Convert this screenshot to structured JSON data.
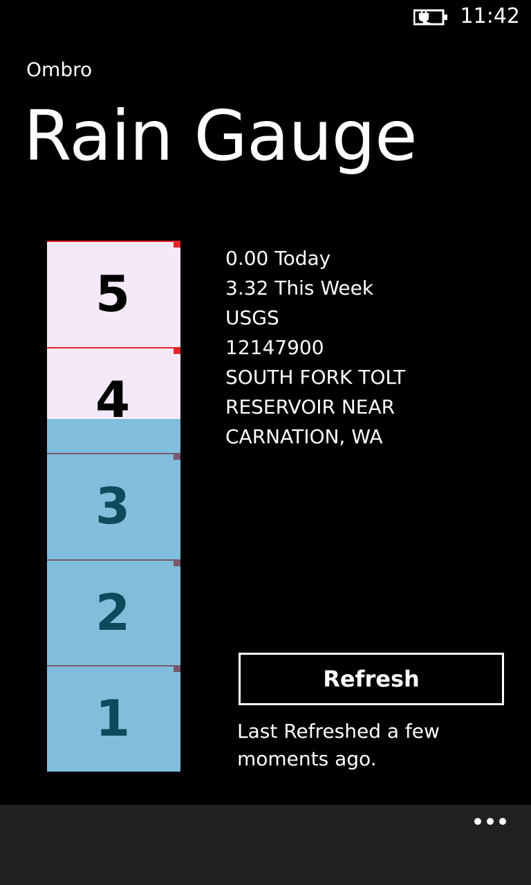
{
  "status_bar": {
    "time": "11:42",
    "battery_icon": "battery-charging-icon"
  },
  "header": {
    "app_title": "Ombro",
    "page_title": "Rain Gauge"
  },
  "gauge": {
    "labels": [
      "5",
      "4",
      "3",
      "2",
      "1"
    ],
    "max": 5,
    "fill_value": 3.32,
    "colors": {
      "empty": "#f5e9f9",
      "fill": "#80bedb",
      "line_empty": "#e8212a",
      "line_filled": "#7a5a6e",
      "label_empty": "#000000",
      "label_filled": "#0c4a5c"
    }
  },
  "info": {
    "today": "0.00 Today",
    "week": "3.32 This Week",
    "agency": "USGS",
    "site_id": "12147900",
    "site_line1": "SOUTH FORK TOLT",
    "site_line2": "RESERVOIR NEAR",
    "site_line3": "CARNATION, WA"
  },
  "refresh": {
    "label": "Refresh",
    "status": "Last Refreshed a few moments ago."
  },
  "app_bar": {
    "more_icon": "more-dots-icon"
  }
}
